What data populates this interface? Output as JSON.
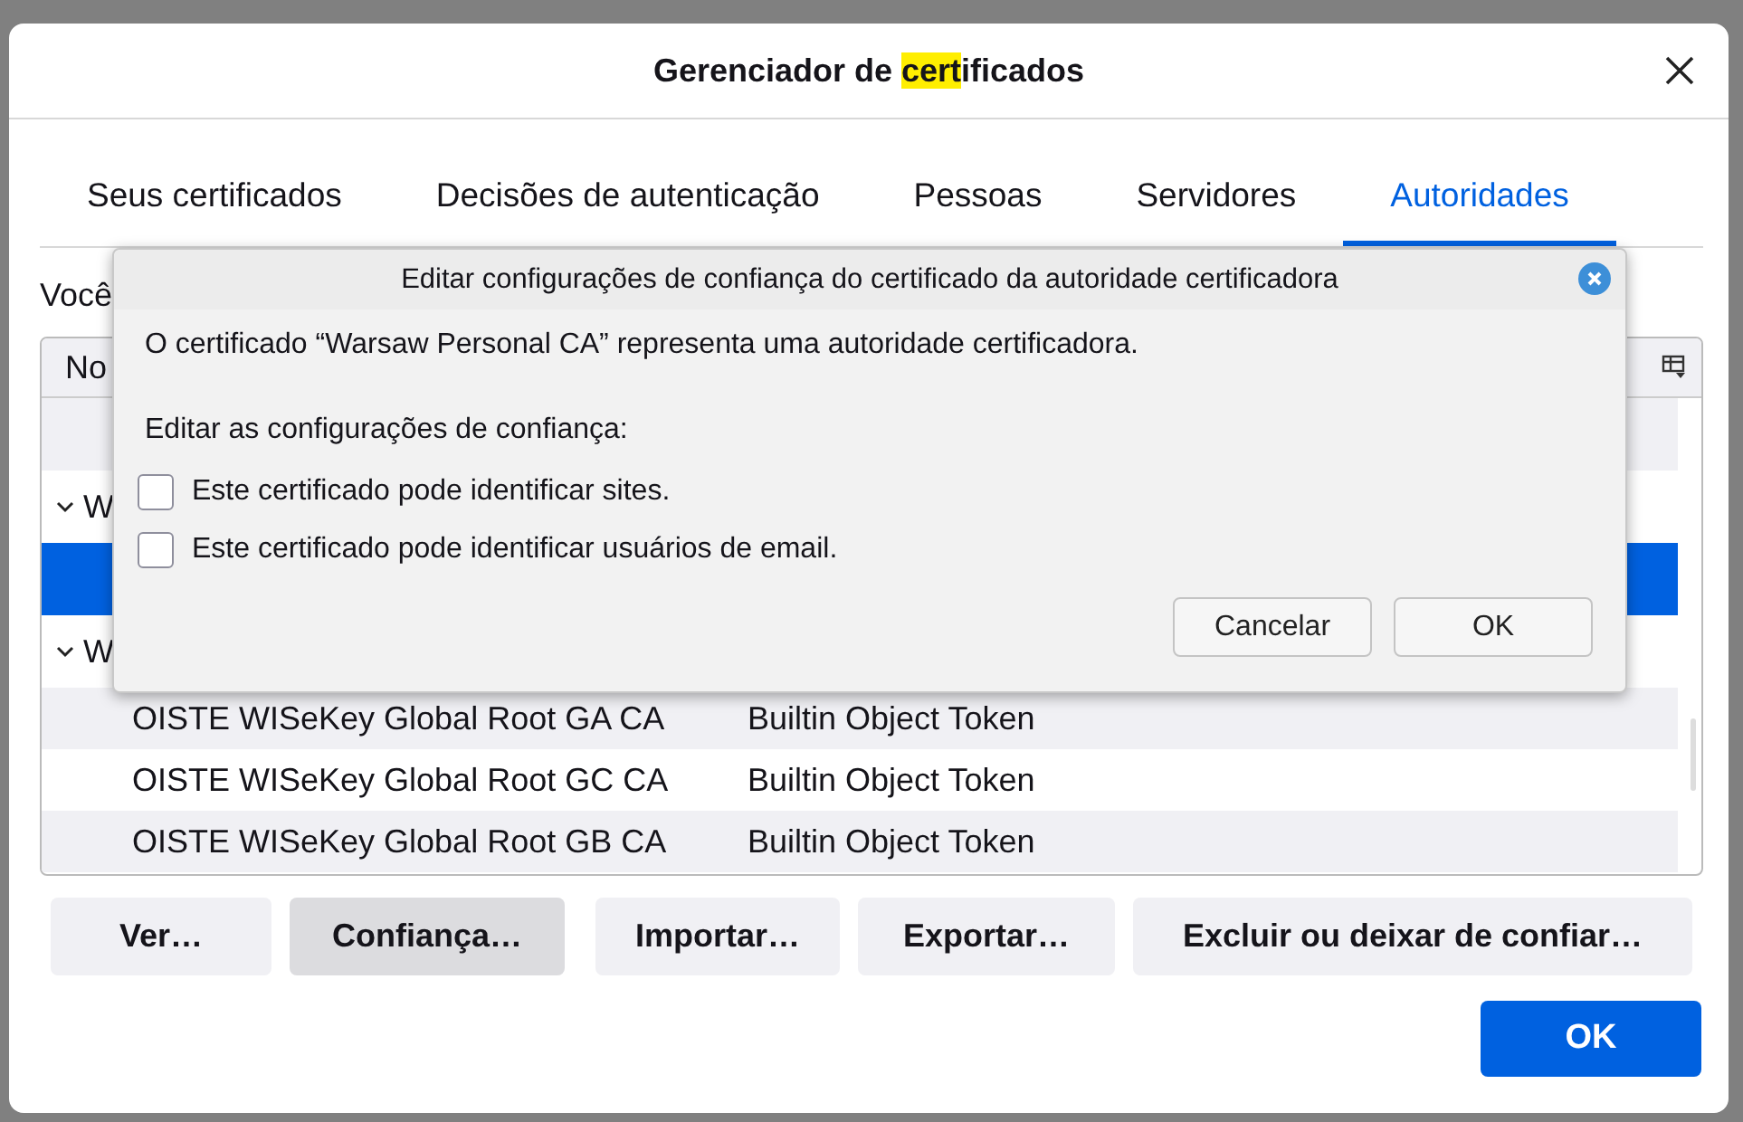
{
  "window": {
    "title": [
      {
        "text": "Gerenciador de ",
        "highlighted": false
      },
      {
        "text": "cert",
        "highlighted": true
      },
      {
        "text": "ificados",
        "highlighted": false
      }
    ]
  },
  "tabs": [
    {
      "label": "Seus certificados",
      "selected": false
    },
    {
      "label": "Decisões de autenticação",
      "selected": false
    },
    {
      "label": "Pessoas",
      "selected": false
    },
    {
      "label": "Servidores",
      "selected": false
    },
    {
      "label": "Autoridades",
      "selected": true
    }
  ],
  "intro": "Você",
  "table": {
    "columns": [
      "No"
    ],
    "rows": [
      {
        "kind": "cert",
        "selected": false
      },
      {
        "kind": "group",
        "name": "W",
        "expanded": true
      },
      {
        "kind": "cert",
        "selected": true
      },
      {
        "kind": "group",
        "name": "W",
        "expanded": true
      },
      {
        "kind": "cert",
        "name": "OISTE WISeKey Global Root GA CA",
        "token": "Builtin Object Token",
        "selected": false
      },
      {
        "kind": "cert",
        "name": "OISTE WISeKey Global Root GC CA",
        "token": "Builtin Object Token",
        "selected": false
      },
      {
        "kind": "cert",
        "name": "OISTE WISeKey Global Root GB CA",
        "token": "Builtin Object Token",
        "selected": false
      }
    ]
  },
  "buttons": [
    {
      "label": "Ver…",
      "focused": false
    },
    {
      "label": "Confiança…",
      "focused": true
    },
    {
      "label": "Importar…",
      "focused": false
    },
    {
      "label": "Exportar…",
      "focused": false
    },
    {
      "label": "Excluir ou deixar de confiar…",
      "focused": false
    }
  ],
  "ok_button": "OK",
  "trust_dialog": {
    "title": "Editar configurações de confiança do certificado da autoridade certificadora",
    "message": "O certificado “Warsaw Personal CA” representa uma autoridade certificadora.",
    "section_label": "Editar as configurações de confiança:",
    "options": [
      {
        "label": "Este certificado pode identificar sites.",
        "checked": false
      },
      {
        "label": "Este certificado pode identificar usuários de email.",
        "checked": false
      }
    ],
    "buttons": [
      "Cancelar",
      "OK"
    ]
  }
}
